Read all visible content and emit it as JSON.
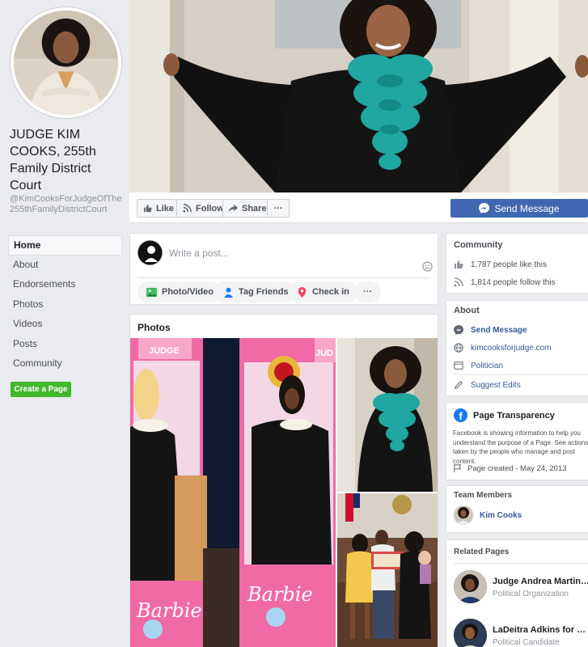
{
  "profile": {
    "name": "JUDGE KIM COOKS, 255th Family District Court",
    "handle": "@KimCooksForJudgeOfThe255thFamilyDistrictCourt"
  },
  "nav": {
    "items": [
      {
        "label": "Home",
        "active": true
      },
      {
        "label": "About",
        "active": false
      },
      {
        "label": "Endorsements",
        "active": false
      },
      {
        "label": "Photos",
        "active": false
      },
      {
        "label": "Videos",
        "active": false
      },
      {
        "label": "Posts",
        "active": false
      },
      {
        "label": "Community",
        "active": false
      }
    ],
    "create_page": "Create a Page"
  },
  "actions": {
    "like": "Like",
    "follow": "Follow",
    "share": "Share",
    "more": "···",
    "send_message": "Send Message"
  },
  "composer": {
    "placeholder": "Write a post...",
    "photo_video": "Photo/Video",
    "tag_friends": "Tag Friends",
    "check_in": "Check in",
    "more": "···"
  },
  "photos": {
    "title": "Photos",
    "box_label_1": "JUDGE",
    "box_label_2": "JUD",
    "barbie_logo": "Barbie"
  },
  "community": {
    "title": "Community",
    "likes": "1,787 people like this",
    "follows": "1,814 people follow this"
  },
  "about": {
    "title": "About",
    "send_message": "Send Message",
    "website": "kimcooksforjudge.com",
    "category": "Politician",
    "suggest_edits": "Suggest Edits"
  },
  "transparency": {
    "title": "Page Transparency",
    "text": "Facebook is showing information to help you understand the purpose of a Page. See actions taken by the people who manage and post content.",
    "created": "Page created - May 24, 2013"
  },
  "team": {
    "title": "Team Members",
    "member": "Kim Cooks"
  },
  "related": {
    "title": "Related Pages",
    "pages": [
      {
        "name": "Judge Andrea Martin ...",
        "category": "Political Organization"
      },
      {
        "name": "LaDeitra Adkins for Ju...",
        "category": "Political Candidate"
      }
    ]
  },
  "colors": {
    "brand_blue": "#4267b2",
    "link_blue": "#385898",
    "create_green": "#42b72a",
    "teal_jabot": "#1fa7a0"
  }
}
